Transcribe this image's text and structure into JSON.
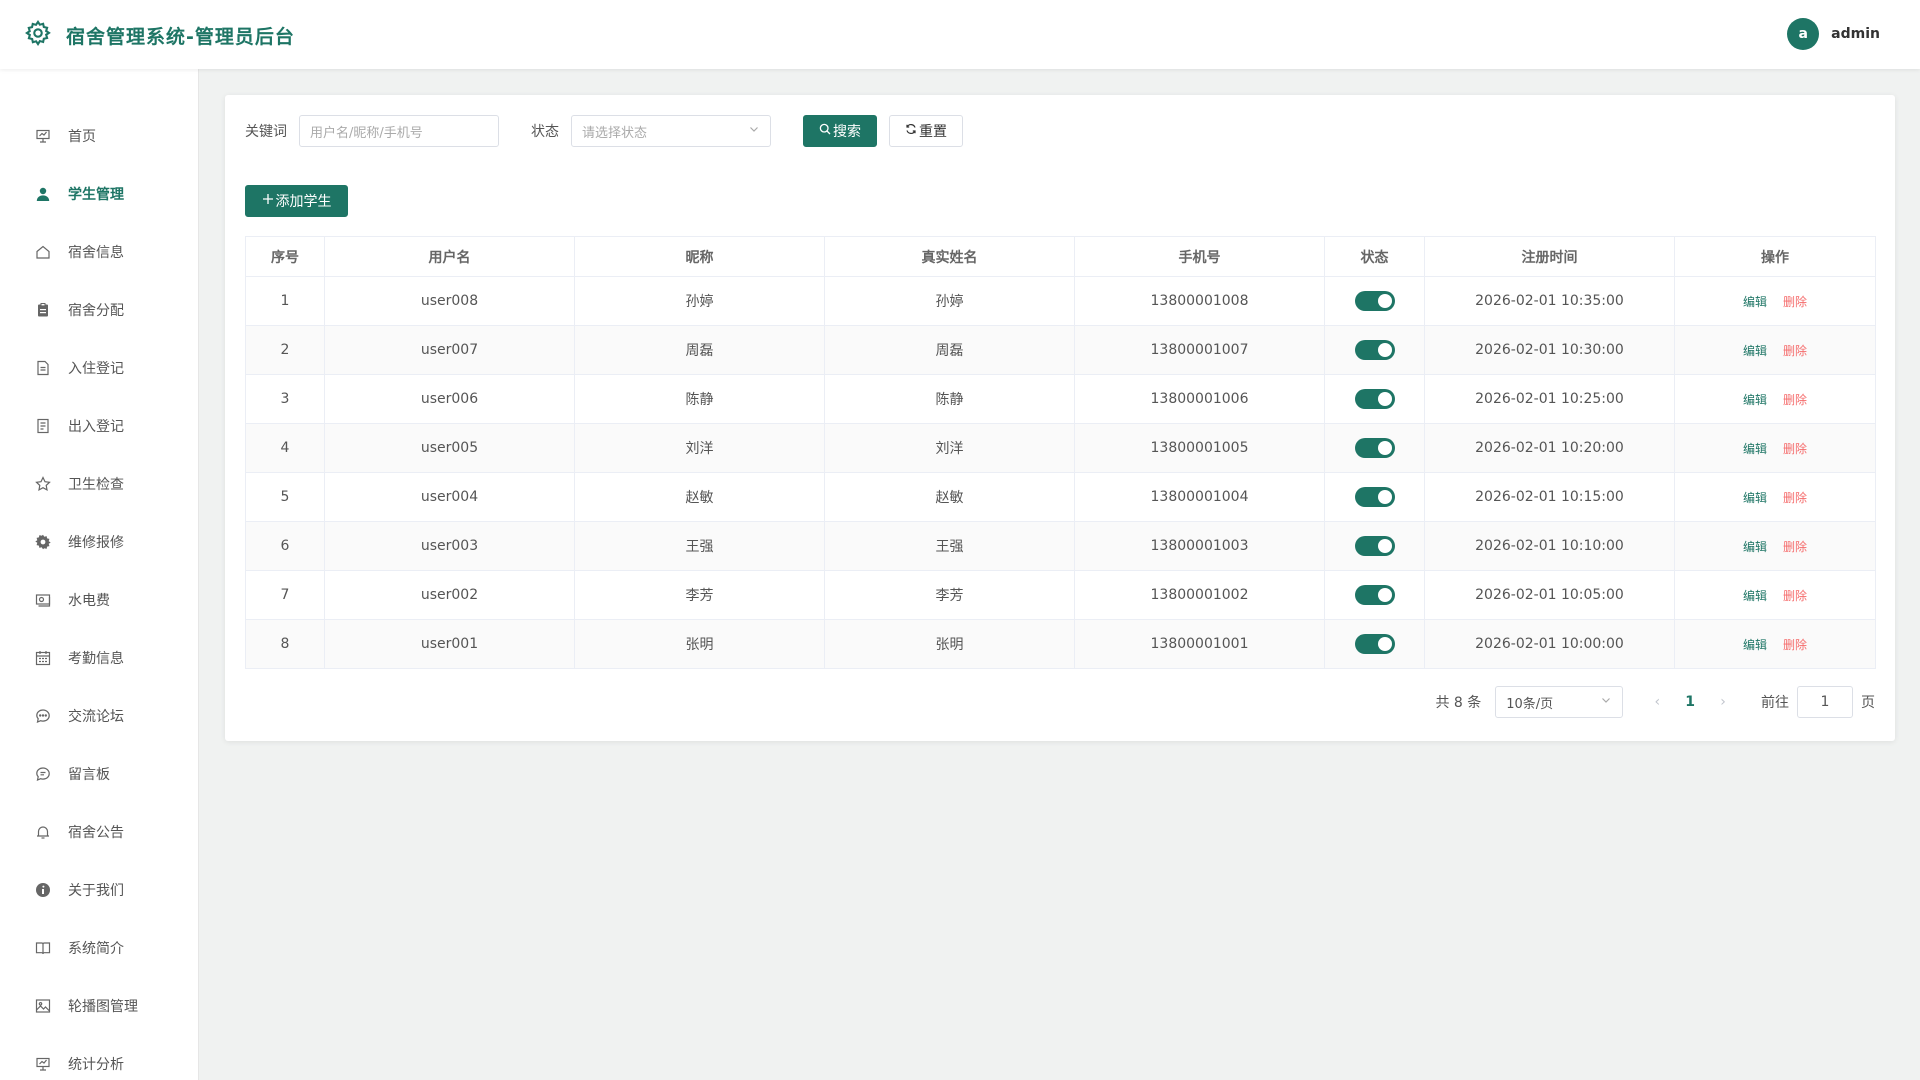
{
  "header": {
    "title": "宿舍管理系统-管理员后台",
    "avatar_letter": "a",
    "username": "admin"
  },
  "sidebar": {
    "items": [
      {
        "label": "首页",
        "icon": "presentation-icon"
      },
      {
        "label": "学生管理",
        "icon": "user-icon",
        "active": true
      },
      {
        "label": "宿舍信息",
        "icon": "home-icon"
      },
      {
        "label": "宿舍分配",
        "icon": "clipboard-icon"
      },
      {
        "label": "入住登记",
        "icon": "document-icon"
      },
      {
        "label": "出入登记",
        "icon": "tickets-icon"
      },
      {
        "label": "卫生检查",
        "icon": "star-icon"
      },
      {
        "label": "维修报修",
        "icon": "gear-icon"
      },
      {
        "label": "水电费",
        "icon": "money-icon"
      },
      {
        "label": "考勤信息",
        "icon": "calendar-icon"
      },
      {
        "label": "交流论坛",
        "icon": "chat-dots-icon"
      },
      {
        "label": "留言板",
        "icon": "chat-lines-icon"
      },
      {
        "label": "宿舍公告",
        "icon": "bell-icon"
      },
      {
        "label": "关于我们",
        "icon": "info-icon"
      },
      {
        "label": "系统简介",
        "icon": "book-icon"
      },
      {
        "label": "轮播图管理",
        "icon": "picture-icon"
      },
      {
        "label": "统计分析",
        "icon": "data-board-icon"
      }
    ]
  },
  "filter": {
    "keyword_label": "关键词",
    "keyword_placeholder": "用户名/昵称/手机号",
    "status_label": "状态",
    "status_placeholder": "请选择状态",
    "search_label": "搜索",
    "reset_label": "重置"
  },
  "add_button_label": "添加学生",
  "table": {
    "columns": [
      "序号",
      "用户名",
      "昵称",
      "真实姓名",
      "手机号",
      "状态",
      "注册时间",
      "操作"
    ],
    "edit_label": "编辑",
    "delete_label": "删除",
    "rows": [
      {
        "index": "1",
        "username": "user008",
        "nickname": "孙婷",
        "realname": "孙婷",
        "phone": "13800001008",
        "enabled": true,
        "registered": "2026-02-01 10:35:00"
      },
      {
        "index": "2",
        "username": "user007",
        "nickname": "周磊",
        "realname": "周磊",
        "phone": "13800001007",
        "enabled": true,
        "registered": "2026-02-01 10:30:00"
      },
      {
        "index": "3",
        "username": "user006",
        "nickname": "陈静",
        "realname": "陈静",
        "phone": "13800001006",
        "enabled": true,
        "registered": "2026-02-01 10:25:00"
      },
      {
        "index": "4",
        "username": "user005",
        "nickname": "刘洋",
        "realname": "刘洋",
        "phone": "13800001005",
        "enabled": true,
        "registered": "2026-02-01 10:20:00"
      },
      {
        "index": "5",
        "username": "user004",
        "nickname": "赵敏",
        "realname": "赵敏",
        "phone": "13800001004",
        "enabled": true,
        "registered": "2026-02-01 10:15:00"
      },
      {
        "index": "6",
        "username": "user003",
        "nickname": "王强",
        "realname": "王强",
        "phone": "13800001003",
        "enabled": true,
        "registered": "2026-02-01 10:10:00"
      },
      {
        "index": "7",
        "username": "user002",
        "nickname": "李芳",
        "realname": "李芳",
        "phone": "13800001002",
        "enabled": true,
        "registered": "2026-02-01 10:05:00"
      },
      {
        "index": "8",
        "username": "user001",
        "nickname": "张明",
        "realname": "张明",
        "phone": "13800001001",
        "enabled": true,
        "registered": "2026-02-01 10:00:00"
      }
    ]
  },
  "pagination": {
    "total_text": "共 8 条",
    "page_size": "10条/页",
    "current_page": "1",
    "goto_label": "前往",
    "goto_value": "1",
    "page_suffix": "页"
  },
  "colors": {
    "accent": "#1e7565",
    "danger": "#f56c6c"
  }
}
